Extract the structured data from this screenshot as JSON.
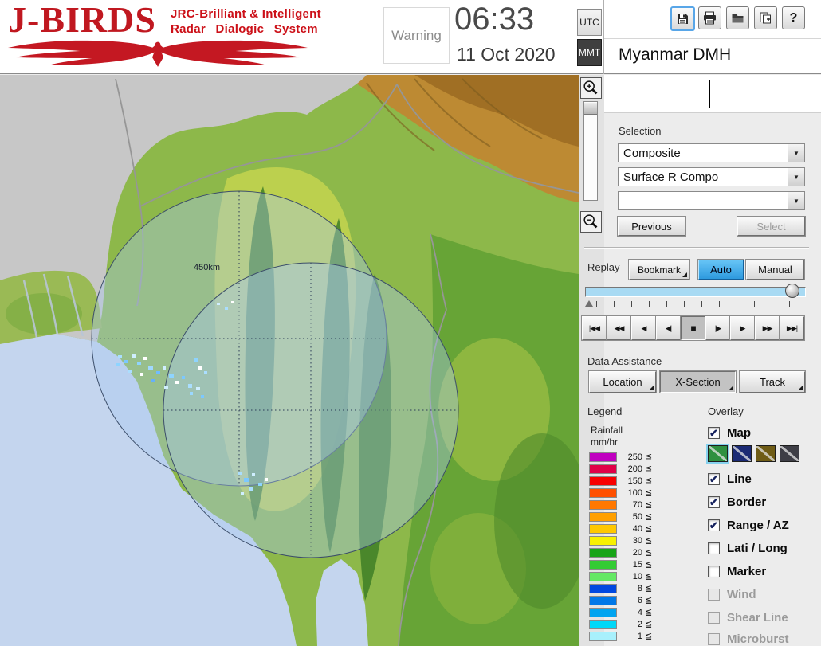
{
  "header": {
    "app_title": "J-BIRDS",
    "tagline1": "JRC-Brilliant & Intelligent",
    "tagline2": "Radar  Dialogic  System",
    "warning": "Warning",
    "time": "06:33",
    "date": "11 Oct 2020",
    "tz_utc": "UTC",
    "tz_mmt": "MMT",
    "org": "Myanmar DMH",
    "help_glyph": "?"
  },
  "map": {
    "range_label": "450km"
  },
  "panel": {
    "selection": {
      "label": "Selection",
      "dropdown1": "Composite",
      "dropdown2": "Surface R Compo",
      "dropdown3": "",
      "previous": "Previous",
      "select": "Select"
    },
    "replay": {
      "label": "Replay",
      "bookmark": "Bookmark",
      "auto": "Auto",
      "manual": "Manual",
      "playback": [
        "|◀◀",
        "◀◀",
        "◀",
        "◀|",
        "■",
        "|▶",
        "▶",
        "▶▶",
        "▶▶|"
      ]
    },
    "data_assistance": {
      "label": "Data Assistance",
      "location": "Location",
      "xsection": "X-Section",
      "track": "Track"
    },
    "legend": {
      "label": "Legend",
      "unit_line1": "Rainfall",
      "unit_line2": "mm/hr",
      "suffix": "≦",
      "rows": [
        {
          "value": "250",
          "color": "#c000c0"
        },
        {
          "value": "200",
          "color": "#e00048"
        },
        {
          "value": "150",
          "color": "#f80000"
        },
        {
          "value": "100",
          "color": "#ff5000"
        },
        {
          "value": "70",
          "color": "#ff7800"
        },
        {
          "value": "50",
          "color": "#ffa000"
        },
        {
          "value": "40",
          "color": "#ffc800"
        },
        {
          "value": "30",
          "color": "#f8f000"
        },
        {
          "value": "20",
          "color": "#18a418"
        },
        {
          "value": "15",
          "color": "#34cc34"
        },
        {
          "value": "10",
          "color": "#64e864"
        },
        {
          "value": "8",
          "color": "#0048e0"
        },
        {
          "value": "6",
          "color": "#0078e8"
        },
        {
          "value": "4",
          "color": "#00a4f0"
        },
        {
          "value": "2",
          "color": "#00d8f8"
        },
        {
          "value": "1",
          "color": "#a8f0fc"
        }
      ]
    },
    "overlay": {
      "label": "Overlay",
      "items": [
        {
          "label": "Map",
          "check": "✔"
        },
        {
          "label": "Line",
          "check": "✔"
        },
        {
          "label": "Border",
          "check": "✔"
        },
        {
          "label": "Range / AZ",
          "check": "✔"
        },
        {
          "label": "Lati / Long",
          "check": ""
        },
        {
          "label": "Marker",
          "check": ""
        },
        {
          "label": "Wind",
          "check": ""
        },
        {
          "label": "Shear Line",
          "check": ""
        },
        {
          "label": "Microburst",
          "check": ""
        }
      ],
      "map_colors": [
        "#2f9040",
        "#1b2a74",
        "#6f5c16",
        "#3e3e46"
      ],
      "accent_blue": "#2e9ade"
    }
  }
}
